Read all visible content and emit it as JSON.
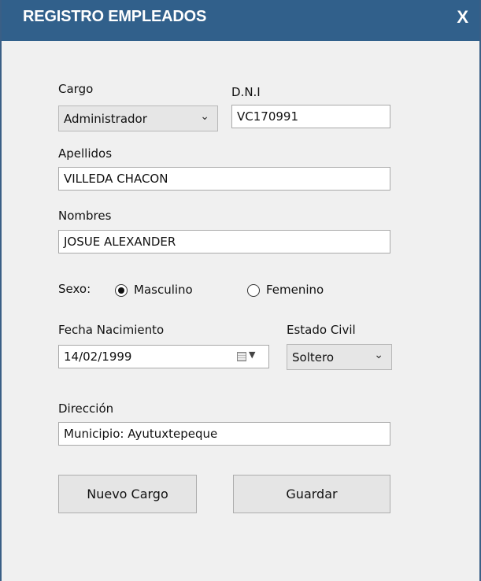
{
  "window": {
    "title": "REGISTRO EMPLEADOS",
    "close_label": "X"
  },
  "form": {
    "cargo_label": "Cargo",
    "cargo_value": "Administrador",
    "dni_label": "D.N.I",
    "dni_value": "VC170991",
    "apellidos_label": "Apellidos",
    "apellidos_value": "VILLEDA CHACON",
    "nombres_label": "Nombres",
    "nombres_value": "JOSUE ALEXANDER",
    "sexo_label": "Sexo:",
    "sexo_options": [
      {
        "label": "Masculino",
        "selected": true
      },
      {
        "label": "Femenino",
        "selected": false
      }
    ],
    "fecha_label": "Fecha Nacimiento",
    "fecha_value": "14/02/1999",
    "estado_label": "Estado Civil",
    "estado_value": "Soltero",
    "direccion_label": "Dirección",
    "direccion_value": "Municipio: Ayutuxtepeque"
  },
  "buttons": {
    "nuevo_cargo": "Nuevo Cargo",
    "guardar": "Guardar"
  },
  "icons": {
    "close": "close-icon",
    "dropdown": "chevron-down-icon",
    "calendar": "calendar-icon"
  },
  "colors": {
    "titlebar": "#31608b",
    "window_bg": "#f0f0f0"
  }
}
